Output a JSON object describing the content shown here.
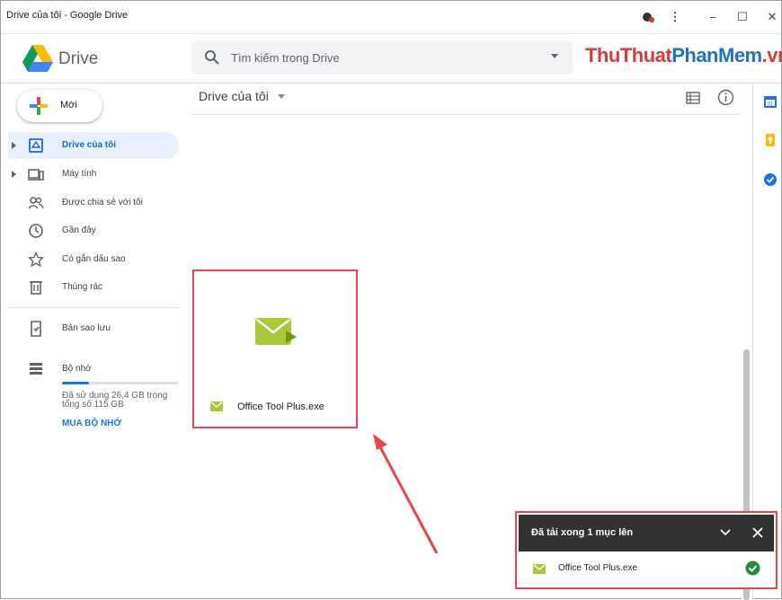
{
  "window": {
    "title": "Drive của tôi - Google Drive",
    "controls": [
      "−",
      "☐",
      "✕"
    ]
  },
  "header": {
    "brand": "Drive",
    "search_placeholder": "Tìm kiếm trong Drive",
    "watermark_part1": "ThuThuat",
    "watermark_part2": "PhanMem",
    "watermark_part3": ".vn"
  },
  "sidebar": {
    "new_label": "Mới",
    "items": [
      {
        "label": "Drive của tôi",
        "icon": "my-drive-icon",
        "active": true,
        "expandable": true
      },
      {
        "label": "Máy tính",
        "icon": "computers-icon",
        "active": false,
        "expandable": true
      },
      {
        "label": "Được chia sẻ với tôi",
        "icon": "shared-icon",
        "active": false,
        "expandable": false
      },
      {
        "label": "Gần đây",
        "icon": "clock-icon",
        "active": false,
        "expandable": false
      },
      {
        "label": "Có gắn dấu sao",
        "icon": "star-icon",
        "active": false,
        "expandable": false
      },
      {
        "label": "Thùng rác",
        "icon": "trash-icon",
        "active": false,
        "expandable": false
      },
      {
        "label": "Bản sao lưu",
        "icon": "backup-icon",
        "active": false,
        "expandable": false
      },
      {
        "label": "Bộ nhớ",
        "icon": "storage-icon",
        "active": false,
        "expandable": false
      }
    ],
    "storage_used_fraction": 0.23,
    "storage_line1": "Đã sử dụng 26,4 GB trong",
    "storage_line2": "tổng số 115 GB",
    "buy_storage": "MUA BỘ NHỚ"
  },
  "main": {
    "breadcrumb": "Drive của tôi",
    "file": {
      "name": "Office Tool Plus.exe",
      "icon": "executable-file-icon"
    }
  },
  "toast": {
    "title": "Đã tải xong 1 mục lên",
    "item_name": "Office Tool Plus.exe",
    "status_icon": "check-circle-icon"
  },
  "colors": {
    "accent": "#1a73e8",
    "highlight_box": "#e8464a",
    "active_nav_bg": "#e8f0fe",
    "toast_header": "#323232",
    "file_icon": "#a8c93a"
  }
}
